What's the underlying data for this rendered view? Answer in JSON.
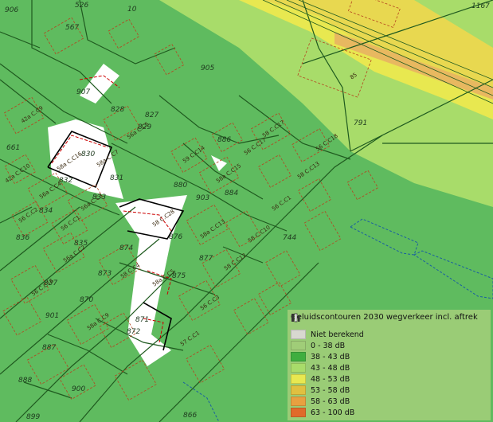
{
  "legend": {
    "title": "Geluidscontouren 2030 wegverkeer incl. aftrek",
    "icon": "layers-icon",
    "items": [
      {
        "label": "Niet berekend",
        "color": "#d8d8d0"
      },
      {
        "label": "0 - 38 dB",
        "color": "#a0cd78"
      },
      {
        "label": "38 - 43 dB",
        "color": "#3fae3f"
      },
      {
        "label": "43 - 48 dB",
        "color": "#a8dc6a"
      },
      {
        "label": "48 - 53 dB",
        "color": "#e8e850"
      },
      {
        "label": "53 - 58 dB",
        "color": "#e0c040"
      },
      {
        "label": "58 - 63 dB",
        "color": "#e8a040"
      },
      {
        "label": "63 - 100 dB",
        "color": "#e06a2a"
      }
    ]
  },
  "parcels": [
    "906",
    "567",
    "905",
    "907",
    "828",
    "827",
    "829",
    "661",
    "886",
    "830",
    "832",
    "831",
    "833",
    "880",
    "903",
    "884",
    "834",
    "836",
    "835",
    "876",
    "744",
    "874",
    "877",
    "875",
    "873",
    "837",
    "870",
    "901",
    "791",
    "871",
    "872",
    "887",
    "900",
    "888",
    "866",
    "899",
    "1167",
    "828",
    "526",
    "10"
  ],
  "buildings": [
    "42a C.C9",
    "42a C.C10",
    "56a C.C5",
    "58a C.C16",
    "56a C.C4",
    "56a C.C3",
    "58a C.C7",
    "56 C.C2",
    "56 C.C1",
    "58 C.C17",
    "58 C.C13",
    "58a C.C15",
    "59 C.C14",
    "56 C.C17",
    "56 C.C18",
    "56 C.C1",
    "58 C.C10",
    "58 C.C12",
    "58a C.C13",
    "58 C.C28",
    "58a C.C5",
    "58 C.C4",
    "56a C.C2",
    "56 C.C16",
    "56 C.C3",
    "58a C.C9",
    "57 C.C1",
    "85"
  ]
}
